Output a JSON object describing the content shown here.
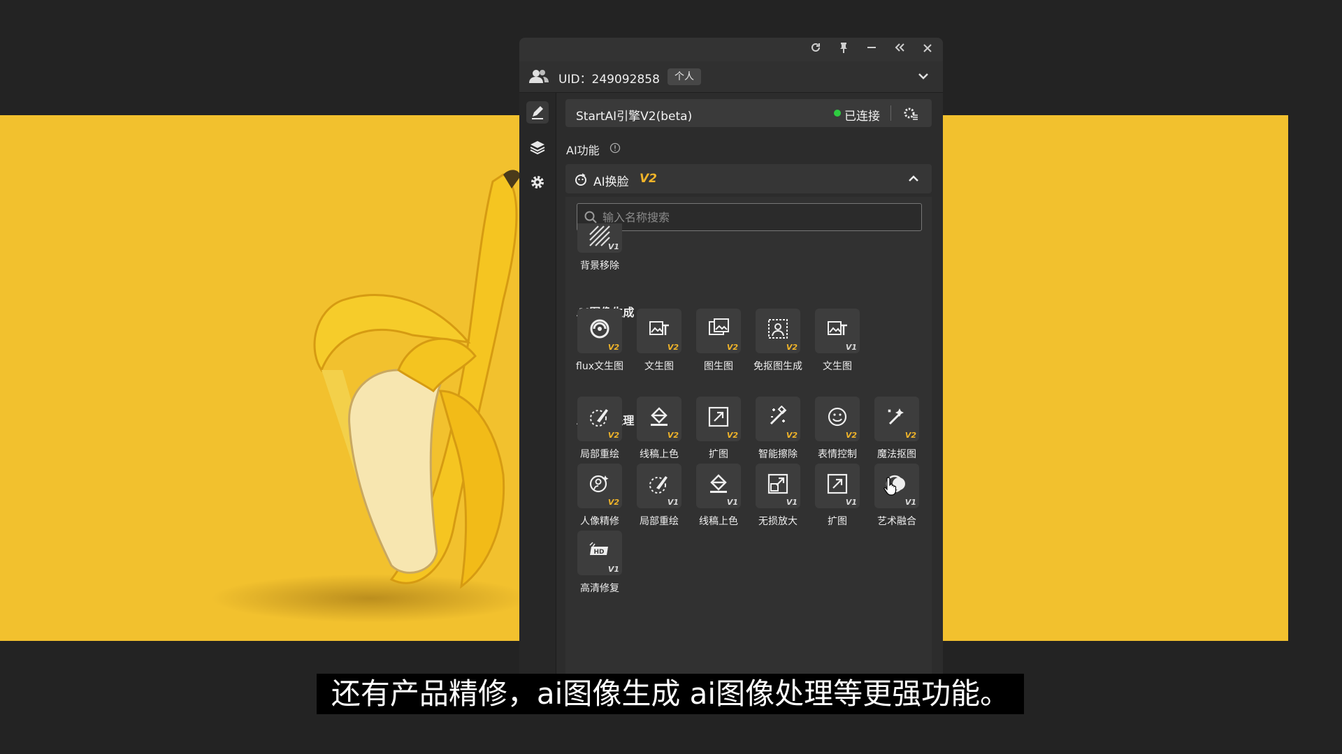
{
  "colors": {
    "canvas": "#f2c12e",
    "accent_v2": "#f0b429",
    "status_connected": "#2ecc40",
    "panel": "#2c2c2c"
  },
  "window": {
    "controls": [
      "refresh-icon",
      "pin-icon",
      "minimize-icon",
      "collapse-icon",
      "close-icon"
    ]
  },
  "account": {
    "uid_text": "UID：249092858",
    "type_badge": "个人"
  },
  "engine": {
    "name": "StartAI引擎V2(beta)",
    "status": "已连接"
  },
  "ai_features": {
    "label": "AI功能"
  },
  "accordion": {
    "title": "AI换脸",
    "version": "V2"
  },
  "search": {
    "placeholder": "输入名称搜索",
    "value": ""
  },
  "top_tool": {
    "label": "背景移除",
    "ver": "V1",
    "icon": "background-remove-icon"
  },
  "groups": [
    {
      "title": "AI图像生成",
      "tools": [
        {
          "label": "flux文生图",
          "ver": "V2",
          "icon": "flux-icon"
        },
        {
          "label": "文生图",
          "ver": "V2",
          "icon": "text-to-image-icon"
        },
        {
          "label": "图生图",
          "ver": "V2",
          "icon": "image-to-image-icon"
        },
        {
          "label": "免抠图生成",
          "ver": "V2",
          "icon": "cutout-free-icon"
        },
        {
          "label": "文生图",
          "ver": "V1",
          "icon": "text-to-image-icon"
        }
      ]
    },
    {
      "title": "AI图像处理",
      "tools": [
        {
          "label": "局部重绘",
          "ver": "V2",
          "icon": "inpaint-icon"
        },
        {
          "label": "线稿上色",
          "ver": "V2",
          "icon": "colorize-icon"
        },
        {
          "label": "扩图",
          "ver": "V2",
          "icon": "expand-icon"
        },
        {
          "label": "智能擦除",
          "ver": "V2",
          "icon": "smart-erase-icon"
        },
        {
          "label": "表情控制",
          "ver": "V2",
          "icon": "face-expression-icon"
        },
        {
          "label": "魔法抠图",
          "ver": "V2",
          "icon": "magic-cutout-icon"
        },
        {
          "label": "人像精修",
          "ver": "V2",
          "icon": "portrait-retouch-icon"
        },
        {
          "label": "局部重绘",
          "ver": "V1",
          "icon": "inpaint-icon"
        },
        {
          "label": "线稿上色",
          "ver": "V1",
          "icon": "colorize-icon"
        },
        {
          "label": "无损放大",
          "ver": "V1",
          "icon": "upscale-icon"
        },
        {
          "label": "扩图",
          "ver": "V1",
          "icon": "expand-icon"
        },
        {
          "label": "艺术融合",
          "ver": "V1",
          "icon": "art-blend-icon"
        },
        {
          "label": "高清修复",
          "ver": "V1",
          "icon": "hd-restore-icon"
        }
      ]
    }
  ],
  "subtitle": "还有产品精修，ai图像生成 ai图像处理等更强功能。"
}
